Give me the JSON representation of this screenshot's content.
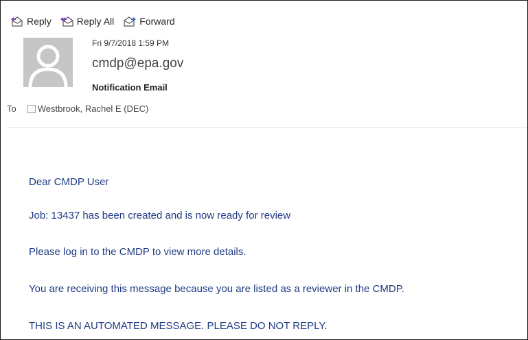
{
  "toolbar": {
    "reply_label": "Reply",
    "reply_all_label": "Reply All",
    "forward_label": "Forward"
  },
  "message": {
    "date": "Fri 9/7/2018 1:59 PM",
    "sender": "cmdp@epa.gov",
    "subject": "Notification Email",
    "to_label": "To",
    "recipient": "Westbrook, Rachel E (DEC)"
  },
  "body": {
    "line1": "Dear CMDP User",
    "line2": "Job: 13437 has been created and is now ready for review",
    "line3": "Please log in to the CMDP to view more details.",
    "line4": "You are receiving this message because you are listed as a reviewer in the CMDP.",
    "line5": "THIS IS AN AUTOMATED MESSAGE. PLEASE DO NOT REPLY."
  },
  "colors": {
    "body_text": "#1f3b84",
    "avatar_bg": "#c6c6c6"
  },
  "icons": {
    "reply": "reply-icon",
    "reply_all": "reply-all-icon",
    "forward": "forward-icon",
    "avatar": "person-silhouette-icon"
  }
}
